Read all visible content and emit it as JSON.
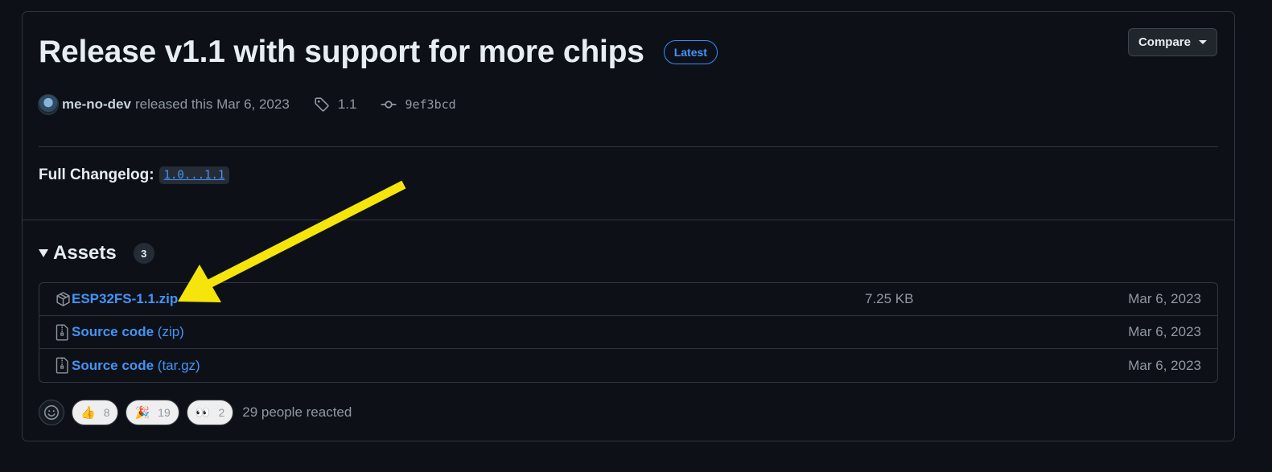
{
  "release": {
    "title": "Release v1.1 with support for more chips",
    "latest_badge": "Latest",
    "compare_label": "Compare"
  },
  "meta": {
    "author": "me-no-dev",
    "released_text": "released this Mar 6, 2023",
    "tag": "1.1",
    "commit": "9ef3bcd"
  },
  "changelog": {
    "label": "Full Changelog:",
    "link": "1.0...1.1"
  },
  "assets": {
    "heading": "Assets",
    "count": "3",
    "items": [
      {
        "name": "ESP32FS-1.1.zip",
        "sub": "",
        "size": "7.25 KB",
        "date": "Mar 6, 2023",
        "icon": "package-icon"
      },
      {
        "name": "Source code",
        "sub": "(zip)",
        "size": "",
        "date": "Mar 6, 2023",
        "icon": "file-zip-icon"
      },
      {
        "name": "Source code",
        "sub": "(tar.gz)",
        "size": "",
        "date": "Mar 6, 2023",
        "icon": "file-zip-icon"
      }
    ]
  },
  "reactions": {
    "items": [
      {
        "emoji": "👍",
        "count": "8",
        "icon": "thumbs-up-icon"
      },
      {
        "emoji": "🎉",
        "count": "19",
        "icon": "tada-icon"
      },
      {
        "emoji": "👀",
        "count": "2",
        "icon": "eyes-icon"
      }
    ],
    "summary": "29 people reacted"
  },
  "colors": {
    "background": "#0d1117",
    "border": "#30363d",
    "link": "#4493f8",
    "muted": "#9198a1",
    "annotation_arrow": "#f5e50b"
  }
}
